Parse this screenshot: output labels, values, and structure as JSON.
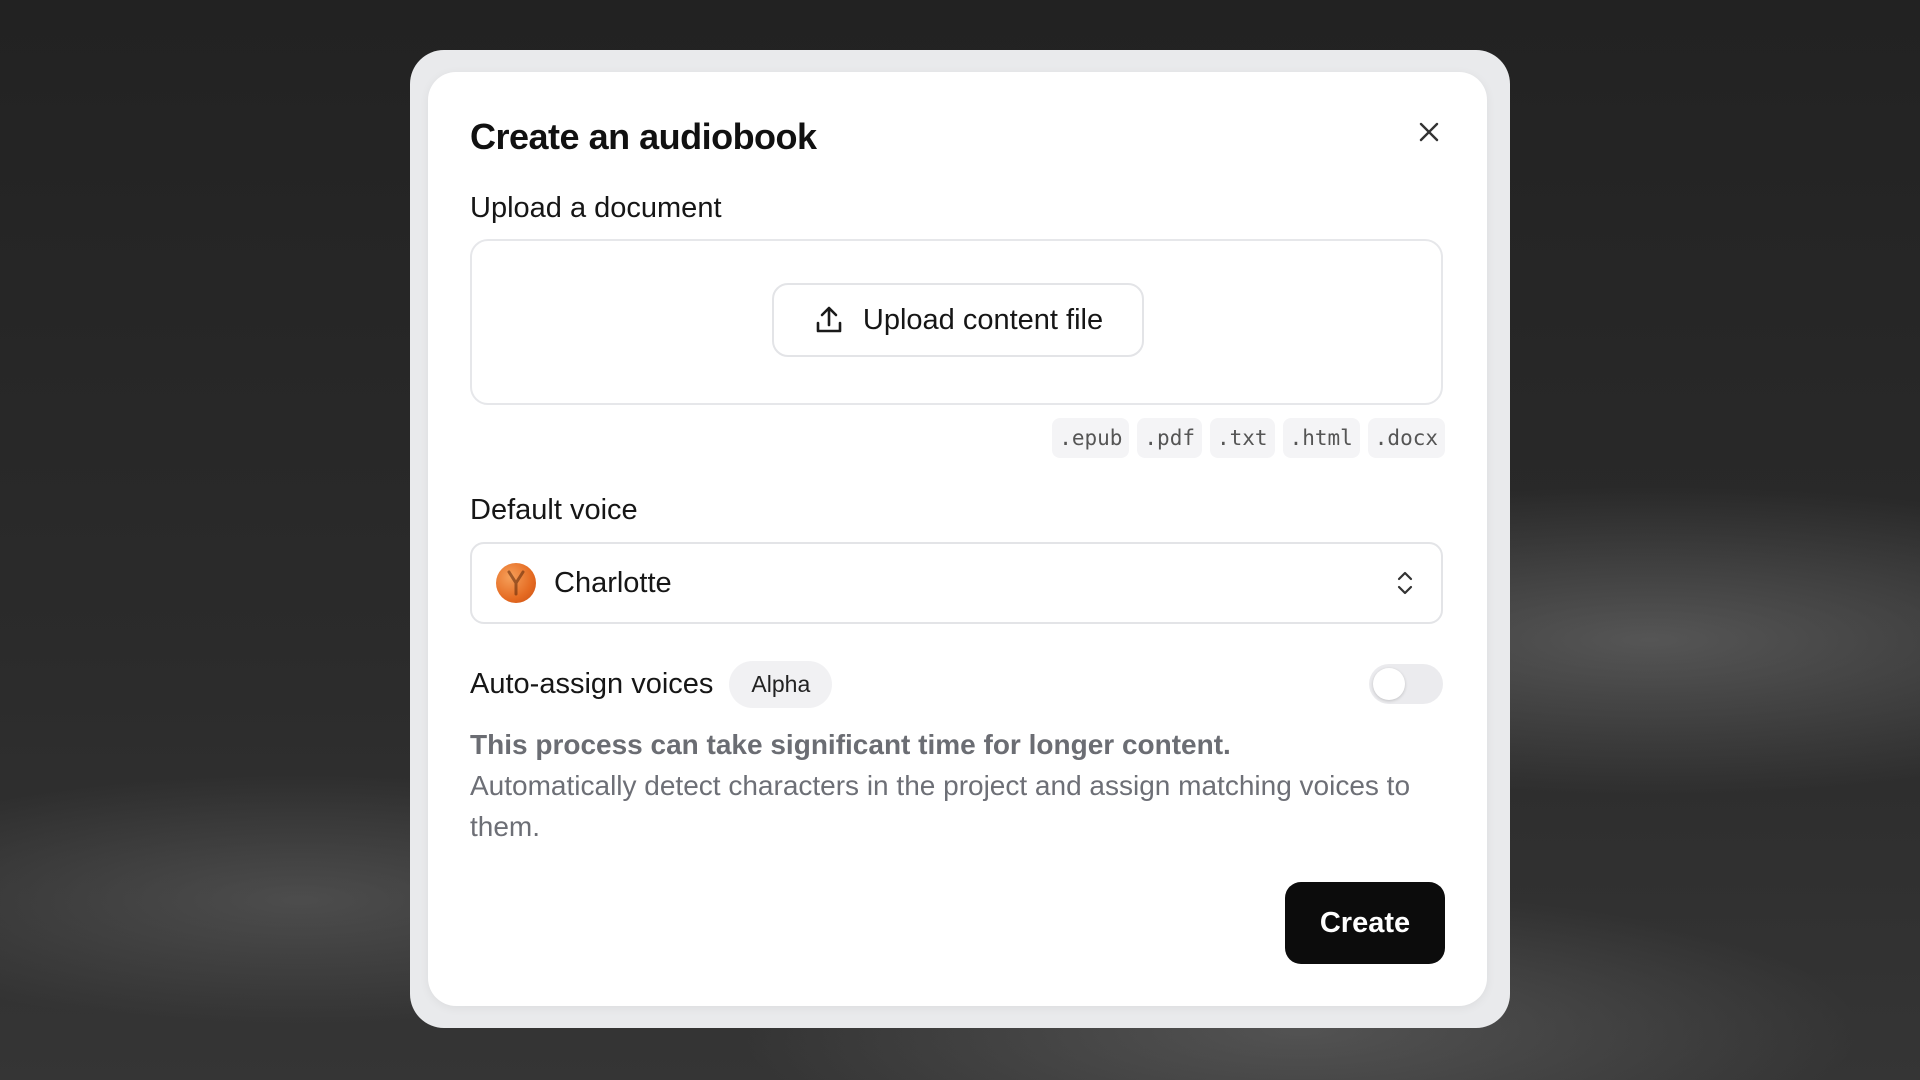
{
  "dialog": {
    "title": "Create an audiobook",
    "close_icon": "close-icon"
  },
  "upload": {
    "label": "Upload a document",
    "button_label": "Upload content file",
    "icon": "upload-icon",
    "extensions": [
      ".epub",
      ".pdf",
      ".txt",
      ".html",
      ".docx"
    ]
  },
  "voice": {
    "label": "Default voice",
    "selected": "Charlotte",
    "icon": "chevron-up-down-icon"
  },
  "auto_assign": {
    "label": "Auto-assign voices",
    "badge": "Alpha",
    "enabled": false,
    "warning": "This process can take significant time for longer content.",
    "description": "Automatically detect characters in the project and assign matching voices to them."
  },
  "actions": {
    "create_label": "Create"
  },
  "colors": {
    "primary_button": "#0c0c0c",
    "muted_text": "#6d6f76",
    "avatar_orange": "#e56b22"
  }
}
